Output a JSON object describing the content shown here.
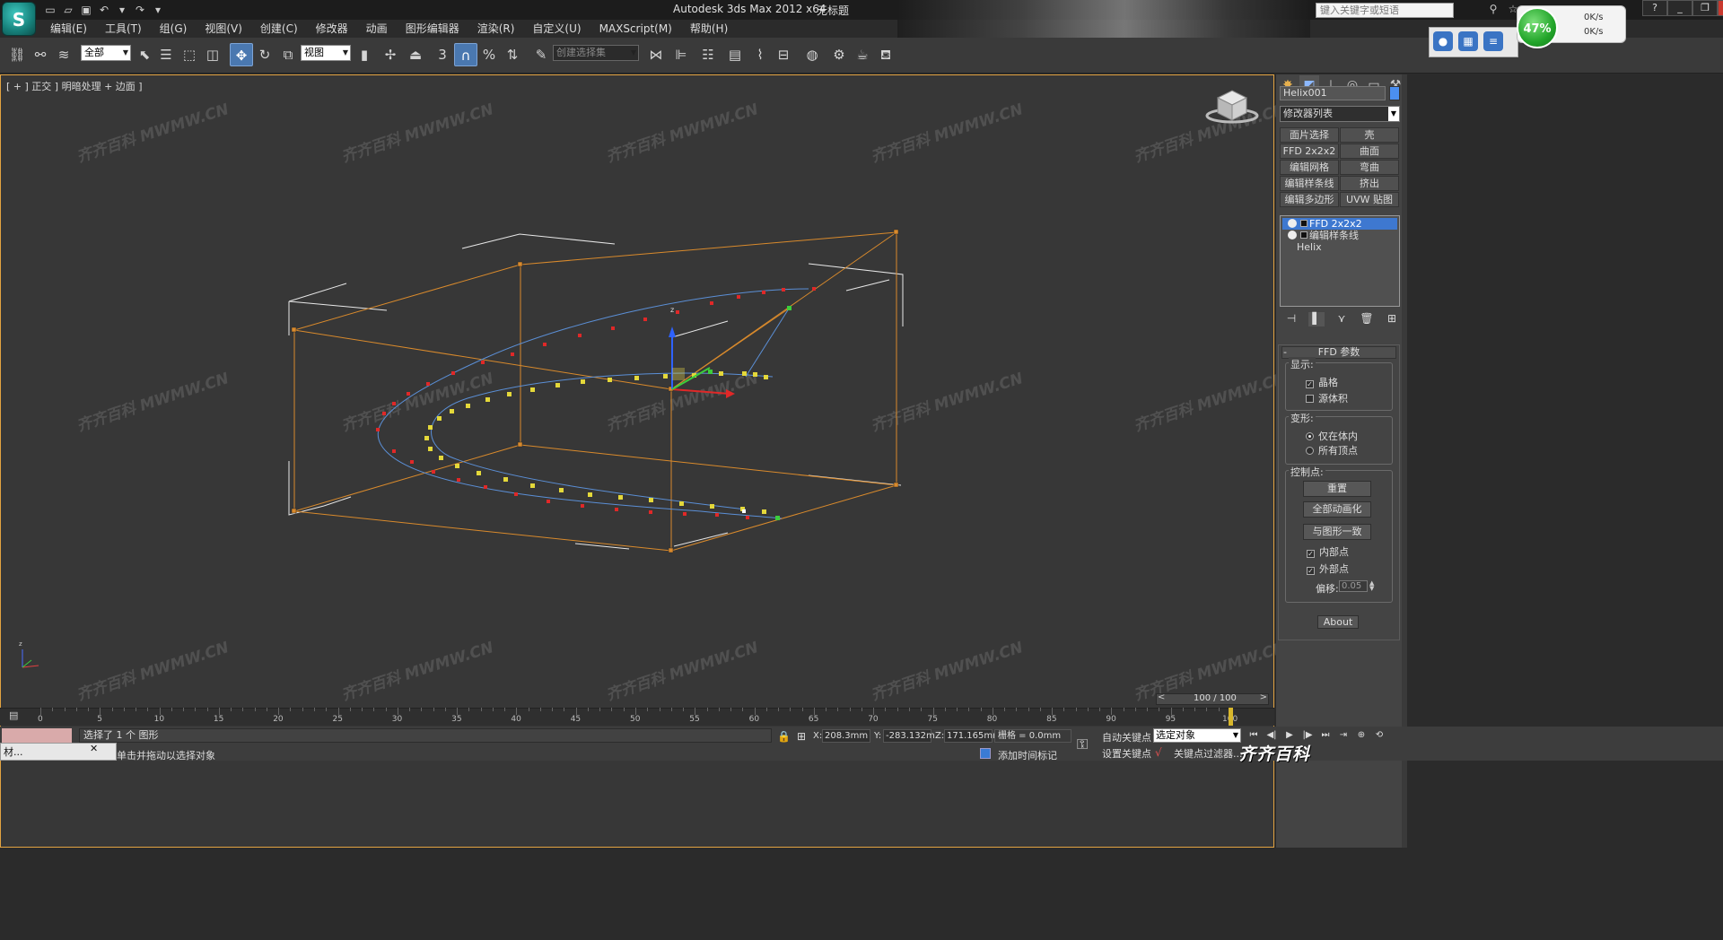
{
  "titlebar": {
    "app_logo": "S",
    "app_title": "Autodesk 3ds Max  2012 x64",
    "doc_title": "无标题",
    "search_placeholder": "键入关键字或短语",
    "quick_access": [
      "new-icon",
      "open-icon",
      "save-icon",
      "undo-icon",
      "redo-icon",
      "dropdown-icon"
    ]
  },
  "menu": [
    "编辑(E)",
    "工具(T)",
    "组(G)",
    "视图(V)",
    "创建(C)",
    "修改器",
    "动画",
    "图形编辑器",
    "渲染(R)",
    "自定义(U)",
    "MAXScript(M)",
    "帮助(H)"
  ],
  "netmon": {
    "percent": "47%",
    "up": "0K/s",
    "down": "0K/s"
  },
  "toolbar": {
    "selection_filter": "全部",
    "ref_coord": "视图",
    "named_selection": "创建选择集",
    "snap_label": "3"
  },
  "viewport": {
    "label": "[ + ] 正交 ] 明暗处理 + 边面 ]",
    "watermark": "MWMW.CN",
    "watermark_brand": "齐齐百科"
  },
  "command_panel": {
    "object_name": "Helix001",
    "object_color": "#4b8ff0",
    "modifier_list": "修改器列表",
    "modifier_buttons": [
      [
        "面片选择",
        "壳"
      ],
      [
        "FFD 2x2x2",
        "曲面"
      ],
      [
        "编辑网格",
        "弯曲"
      ],
      [
        "编辑样条线",
        "挤出"
      ],
      [
        "编辑多边形",
        "UVW 贴图"
      ]
    ],
    "stack": [
      "FFD 2x2x2",
      "编辑样条线",
      "Helix"
    ],
    "rollout_title": "FFD 参数",
    "display_group": "显示:",
    "lattice": "晶格",
    "source_volume": "源体积",
    "deform_group": "变形:",
    "only_in_volume": "仅在体内",
    "all_vertices": "所有顶点",
    "control_points_group": "控制点:",
    "reset": "重置",
    "animate_all": "全部动画化",
    "conform_to_shape": "与图形一致",
    "inside_points": "内部点",
    "outside_points": "外部点",
    "offset_label": "偏移:",
    "offset_value": "0.05",
    "about": "About"
  },
  "timeline": {
    "range": "100 / 100",
    "ticks": [
      "0",
      "5",
      "10",
      "15",
      "20",
      "25",
      "30",
      "35",
      "40",
      "45",
      "50",
      "55",
      "60",
      "65",
      "70",
      "75",
      "80",
      "85",
      "90",
      "95",
      "100"
    ]
  },
  "status": {
    "message": "选择了 1 个 图形",
    "prompt": "单击并拖动以选择对象",
    "x_label": "X:",
    "x_value": "208.3mm",
    "y_label": "Y:",
    "y_value": "-283.132m",
    "z_label": "Z:",
    "z_value": "171.165mm",
    "grid": "栅格 = 0.0mm",
    "add_time_tag": "添加时间标记",
    "auto_key": "自动关键点",
    "set_key": "设置关键点",
    "selection_mode": "选定对象",
    "key_filters": "关键点过滤器...",
    "brand": "齐齐百科"
  },
  "taskbar": {
    "item": "材...",
    "close": "✕"
  }
}
